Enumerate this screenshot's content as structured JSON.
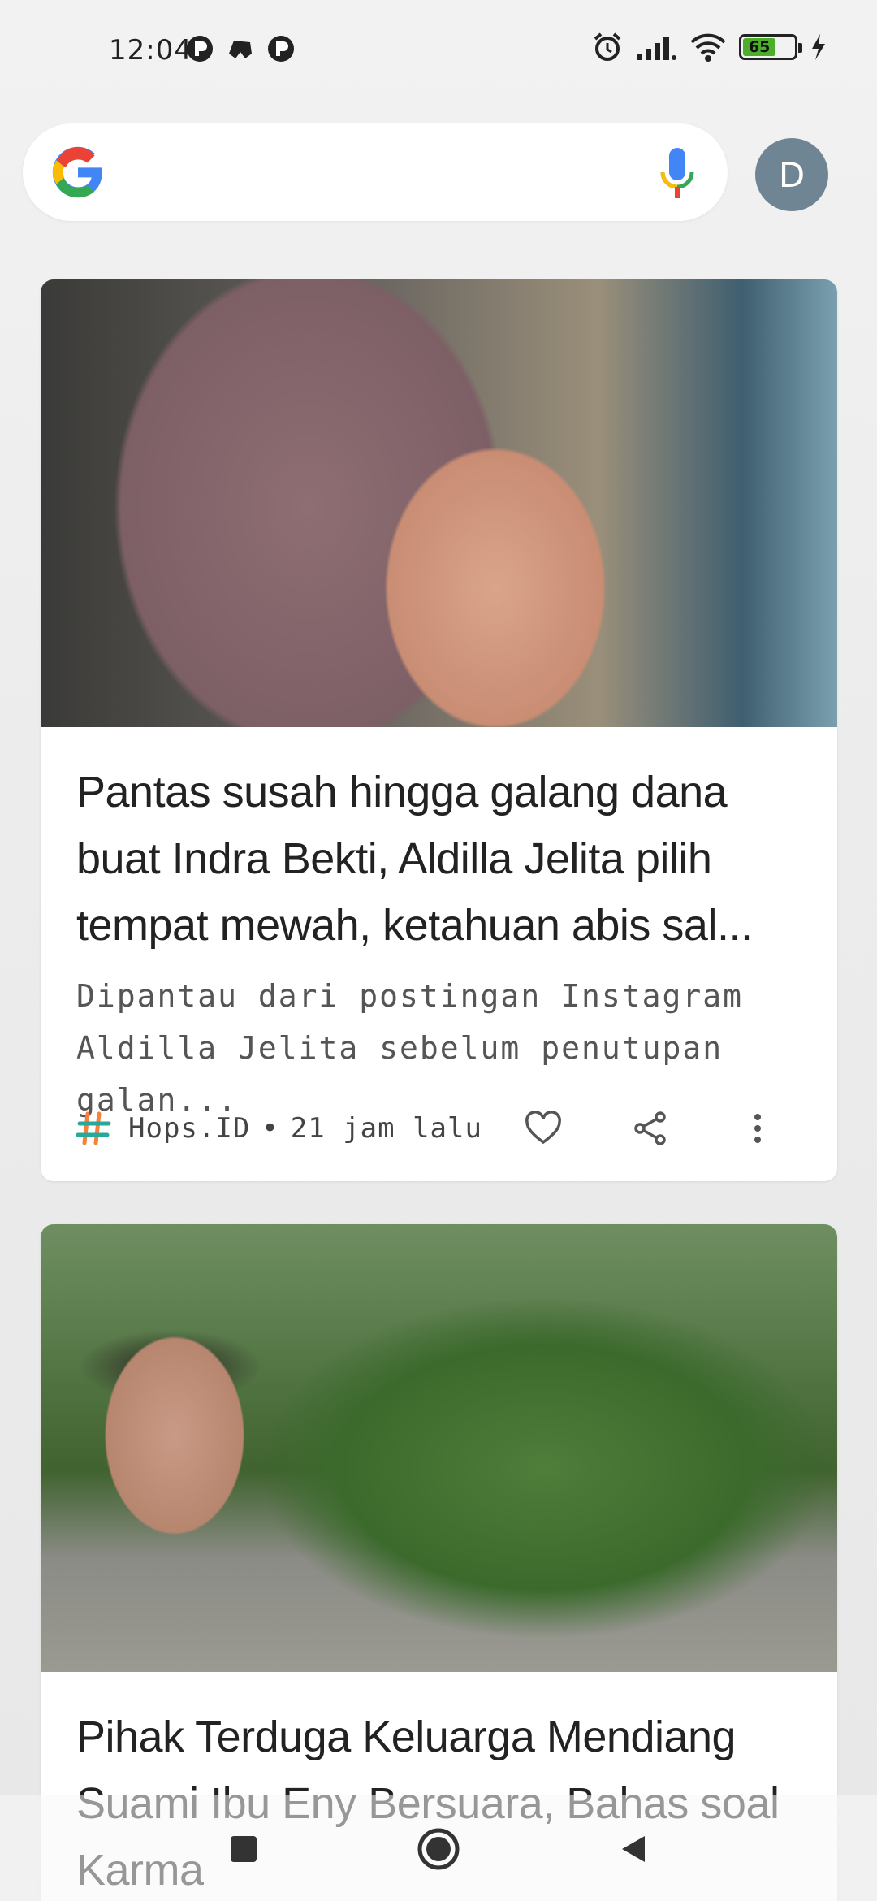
{
  "status_bar": {
    "time": "12:04",
    "battery_level": "65",
    "battery_fraction": 0.65,
    "icons": [
      "notification-app-icon",
      "game-controller-icon",
      "notification-app-icon",
      "alarm-icon",
      "signal-icon",
      "wifi-icon",
      "battery-icon",
      "charging-icon"
    ]
  },
  "search": {
    "placeholder": "",
    "avatar_letter": "D"
  },
  "feed": {
    "cards": [
      {
        "title": "Pantas susah hingga galang dana buat Indra Bekti, Aldilla Jelita pilih tempat mewah, ketahuan abis sal...",
        "snippet": "Dipantau dari postingan Instagram Aldilla Jelita sebelum penutupan galan...",
        "source": "Hops.ID",
        "separator": "•",
        "time": "21 jam lalu"
      },
      {
        "title": "Pihak Terduga Keluarga Mendiang Suami Ibu Eny Bersuara, Bahas soal Karma"
      }
    ]
  },
  "colors": {
    "accent_green": "#4caf2a",
    "avatar_bg": "#6f8594",
    "source_logo_orange": "#f5813a",
    "source_logo_teal": "#28a89a"
  }
}
